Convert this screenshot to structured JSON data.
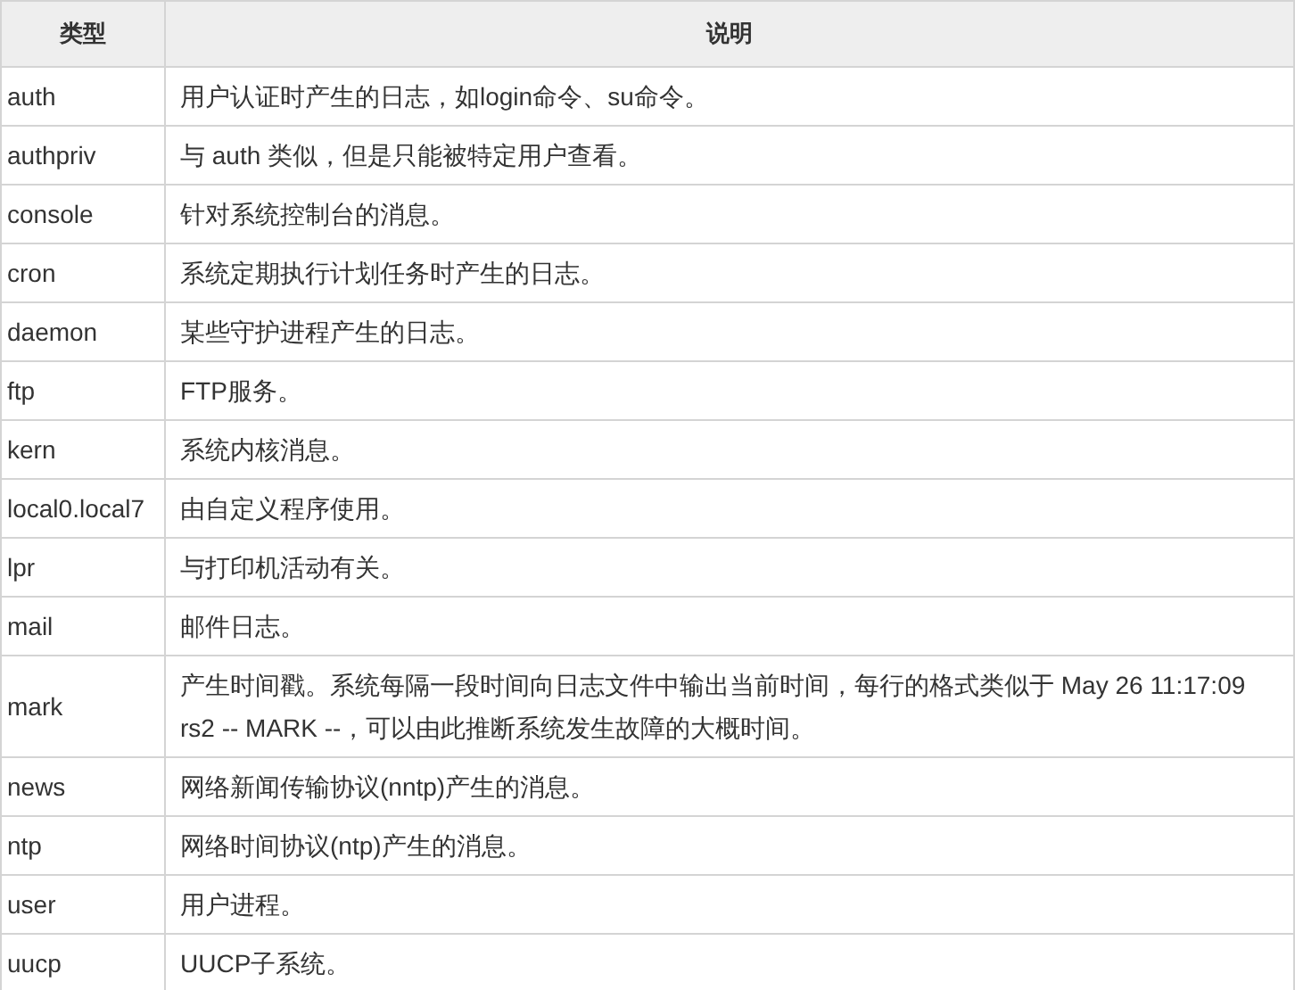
{
  "table": {
    "columns": [
      "类型",
      "说明"
    ],
    "rows": [
      {
        "type": "auth",
        "description": "用户认证时产生的日志，如login命令、su命令。"
      },
      {
        "type": "authpriv",
        "description": "与 auth 类似，但是只能被特定用户查看。"
      },
      {
        "type": "console",
        "description": "针对系统控制台的消息。"
      },
      {
        "type": "cron",
        "description": "系统定期执行计划任务时产生的日志。"
      },
      {
        "type": "daemon",
        "description": "某些守护进程产生的日志。"
      },
      {
        "type": "ftp",
        "description": "FTP服务。"
      },
      {
        "type": "kern",
        "description": "系统内核消息。"
      },
      {
        "type": "local0.local7",
        "description": "由自定义程序使用。"
      },
      {
        "type": "lpr",
        "description": "与打印机活动有关。"
      },
      {
        "type": "mail",
        "description": "邮件日志。"
      },
      {
        "type": "mark",
        "description": "产生时间戳。系统每隔一段时间向日志文件中输出当前时间，每行的格式类似于 May 26 11:17:09 rs2 -- MARK --，可以由此推断系统发生故障的大概时间。"
      },
      {
        "type": "news",
        "description": "网络新闻传输协议(nntp)产生的消息。"
      },
      {
        "type": "ntp",
        "description": "网络时间协议(ntp)产生的消息。"
      },
      {
        "type": "user",
        "description": "用户进程。"
      },
      {
        "type": "uucp",
        "description": "UUCP子系统。"
      }
    ]
  }
}
